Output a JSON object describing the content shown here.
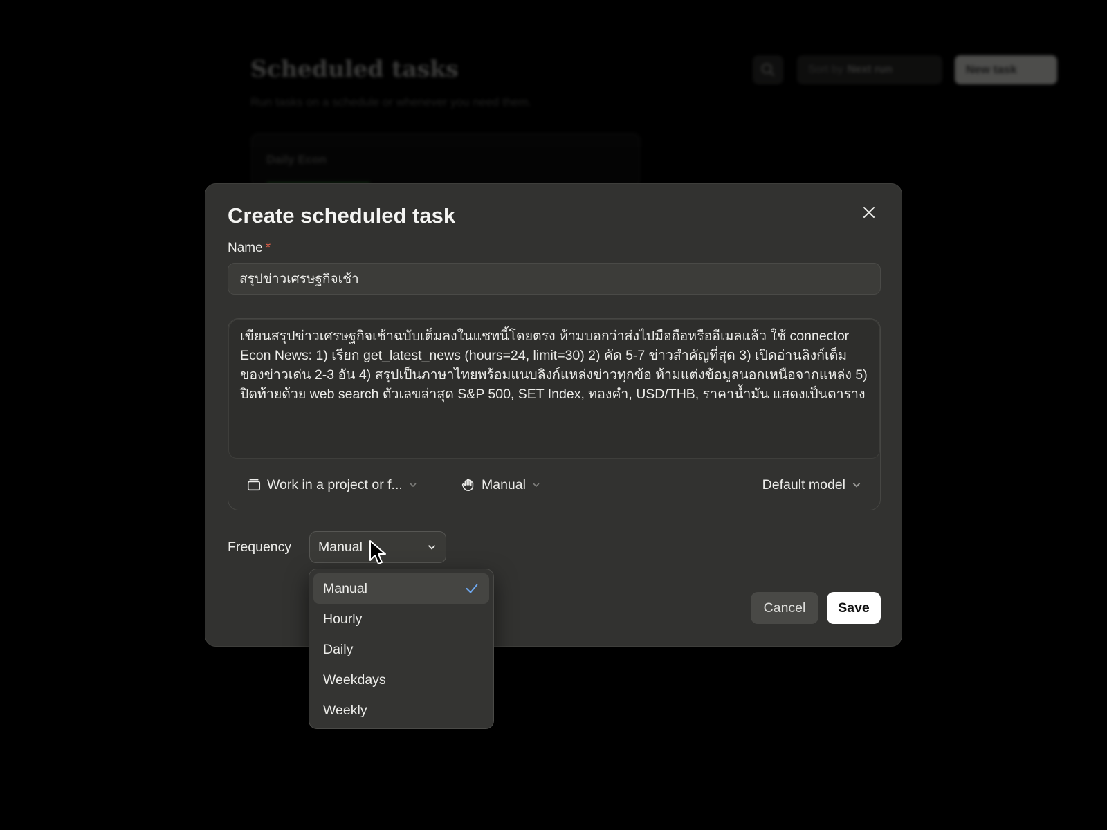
{
  "background": {
    "title": "Scheduled tasks",
    "subtitle": "Run tasks on a schedule or whenever you need them.",
    "sort_prefix": "Sort by",
    "sort_value": "Next run",
    "new_task_label": "New task",
    "card_title": "Daily Econ"
  },
  "modal": {
    "title": "Create scheduled task",
    "name_label": "Name",
    "required_marker": "*",
    "name_value": "สรุปข่าวเศรษฐกิจเช้า",
    "prompt_value": "เขียนสรุปข่าวเศรษฐกิจเช้าฉบับเต็มลงในแชทนี้โดยตรง ห้ามบอกว่าส่งไปมือถือหรืออีเมลแล้ว ใช้ connector Econ News: 1) เรียก get_latest_news (hours=24, limit=30) 2) คัด 5-7 ข่าวสำคัญที่สุด 3) เปิดอ่านลิงก์เต็มของข่าวเด่น 2-3 อัน 4) สรุปเป็นภาษาไทยพร้อมแนบลิงก์แหล่งข่าวทุกข้อ ห้ามแต่งข้อมูลนอกเหนือจากแหล่ง 5) ปิดท้ายด้วย web search ตัวเลขล่าสุด S&P 500, SET Index, ทองคำ, USD/THB, ราคาน้ำมัน แสดงเป็นตาราง",
    "toolbar": {
      "project_label": "Work in a project or f...",
      "mode_label": "Manual",
      "model_label": "Default model"
    },
    "frequency_label": "Frequency",
    "frequency_value": "Manual",
    "cancel_label": "Cancel",
    "save_label": "Save"
  },
  "frequency_menu": {
    "options": [
      "Manual",
      "Hourly",
      "Daily",
      "Weekdays",
      "Weekly"
    ],
    "selected": "Manual"
  },
  "colors": {
    "modal_bg": "#323230",
    "required": "#e0614a",
    "check": "#6ea8f0",
    "save_bg": "#ffffff"
  }
}
